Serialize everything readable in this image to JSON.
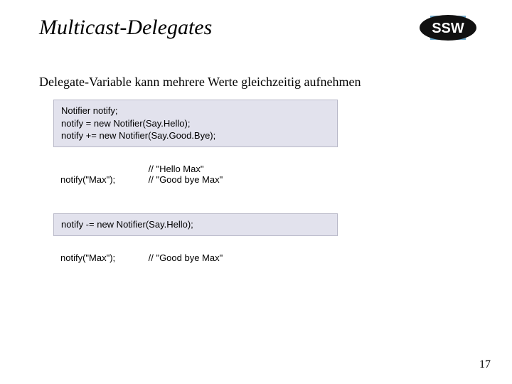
{
  "title": "Multicast-Delegates",
  "subtitle": "Delegate-Variable kann mehrere Werte gleichzeitig aufnehmen",
  "logo": {
    "text": "SSW"
  },
  "code1": "Notifier notify;\nnotify = new Notifier(Say.Hello);\nnotify += new Notifier(Say.Good.Bye);",
  "row1": {
    "call": "notify(\"Max\");",
    "comment": "// \"Hello Max\"\n// \"Good bye Max\""
  },
  "code2": "notify -= new Notifier(Say.Hello);",
  "row2": {
    "call": "notify(\"Max\");",
    "comment": "// \"Good bye Max\""
  },
  "page_number": "17"
}
